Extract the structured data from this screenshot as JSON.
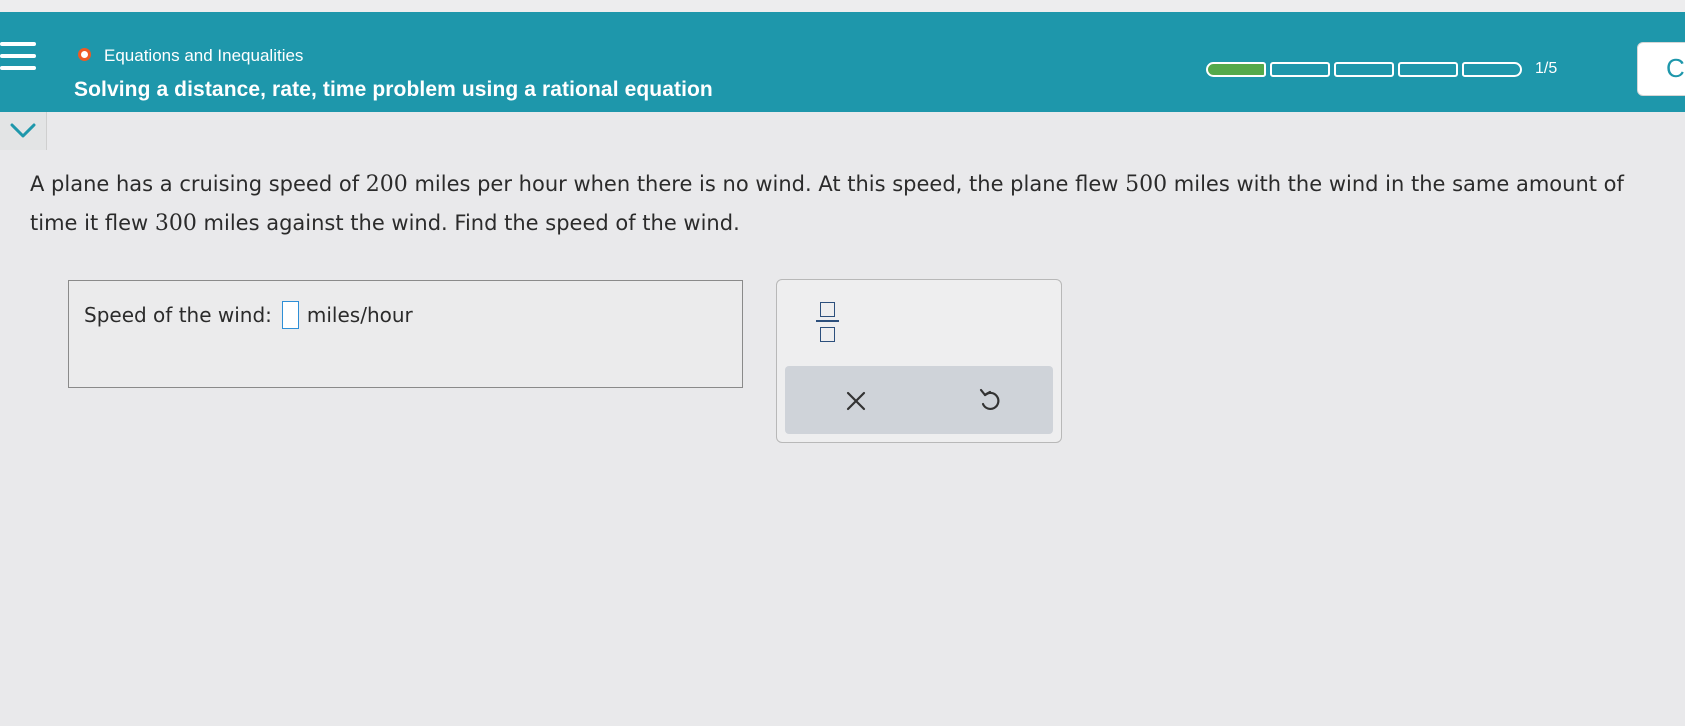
{
  "header": {
    "topic": "Equations and Inequalities",
    "subtitle": "Solving a distance, rate, time problem using a rational equation",
    "progress": {
      "current": 1,
      "total": 5,
      "label": "1/5"
    },
    "corner_button_label": "C"
  },
  "problem": {
    "part1": "A plane has a cruising speed of ",
    "n1": "200",
    "part2": " miles per hour when there is no wind. At this speed, the plane flew ",
    "n2": "500",
    "part3": " miles with the wind in the same amount of time it flew ",
    "n3": "300",
    "part4": " miles against the wind. Find the speed of the wind."
  },
  "answer": {
    "label": "Speed of the wind:",
    "value": "",
    "unit": "miles/hour"
  },
  "colors": {
    "header_bg": "#1e97ab",
    "progress_fill": "#54a94a",
    "status_ring": "#ee5a24",
    "input_border": "#2e8fd6"
  },
  "icons": {
    "menu": "hamburger-menu-icon",
    "collapse": "chevron-down-icon",
    "fraction": "fraction-template-icon",
    "clear": "close-x-icon",
    "undo": "undo-arrow-icon"
  }
}
